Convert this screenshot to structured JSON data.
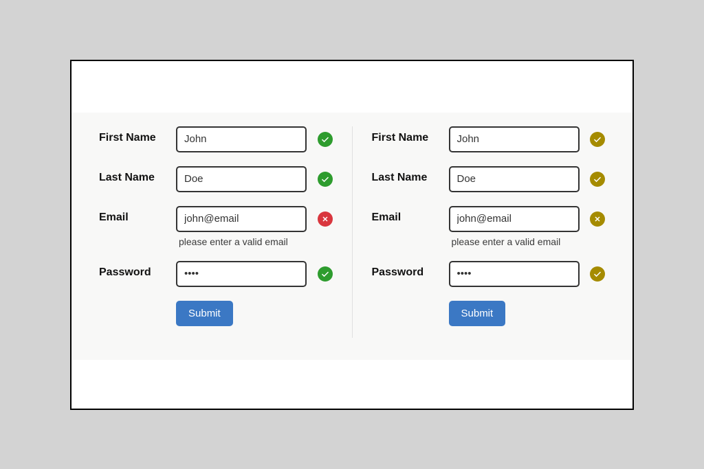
{
  "formLeft": {
    "fields": {
      "firstName": {
        "label": "First Name",
        "value": "John"
      },
      "lastName": {
        "label": "Last Name",
        "value": "Doe"
      },
      "email": {
        "label": "Email",
        "value": "john@email",
        "error": "please enter a valid email"
      },
      "password": {
        "label": "Password",
        "value": "••••"
      }
    },
    "submitLabel": "Submit",
    "colors": {
      "valid": "#2e9c2e",
      "invalid": "#d9363e"
    }
  },
  "formRight": {
    "fields": {
      "firstName": {
        "label": "First Name",
        "value": "John"
      },
      "lastName": {
        "label": "Last Name",
        "value": "Doe"
      },
      "email": {
        "label": "Email",
        "value": "john@email",
        "error": "please enter a valid email"
      },
      "password": {
        "label": "Password",
        "value": "••••"
      }
    },
    "submitLabel": "Submit",
    "colors": {
      "valid": "#a58b00",
      "invalid": "#a58b00"
    }
  }
}
